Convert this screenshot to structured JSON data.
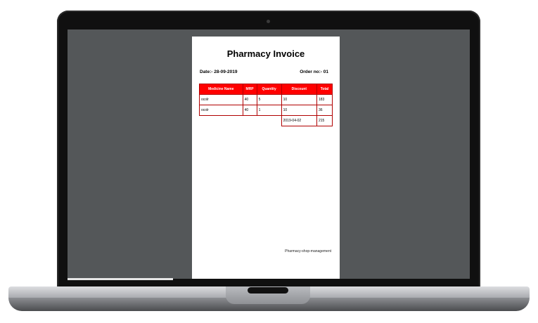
{
  "invoice": {
    "title": "Pharmacy Invoice",
    "date_text": "Date:- 28-09-2019",
    "order_text": "Order no:- 01",
    "columns": [
      "Medicine Name",
      "MRP",
      "Quantity",
      "Discount",
      "Total"
    ],
    "rows": [
      [
        "ocolr",
        "40",
        "5",
        "10",
        "183"
      ],
      [
        "ocolr",
        "40",
        "1",
        "10",
        "36"
      ]
    ],
    "summary": {
      "discount": "2019-04-02",
      "total": "215"
    },
    "footer": "Pharmacy-shop-management"
  },
  "colors": {
    "header_red": "#ff0000",
    "screen_gray": "#545759"
  }
}
